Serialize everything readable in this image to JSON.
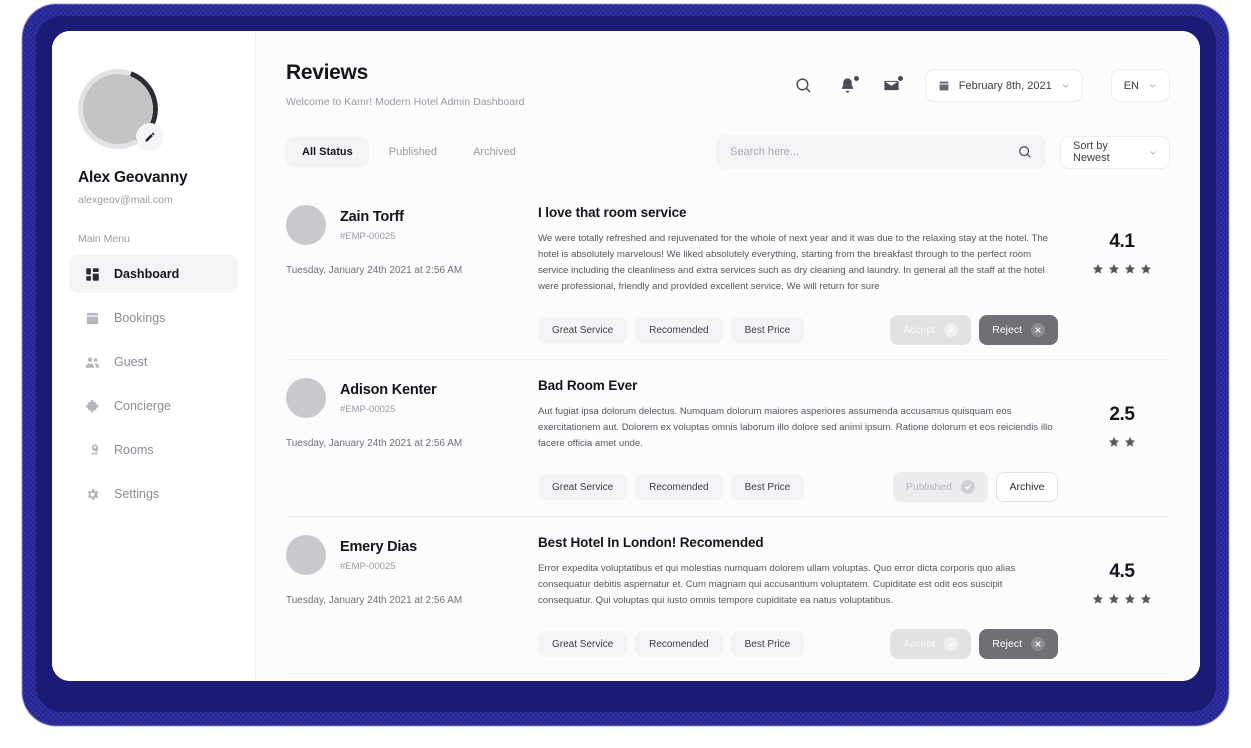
{
  "sidebar": {
    "profile": {
      "name": "Alex Geovanny",
      "email": "alexgeov@mail.com",
      "edit_icon": "pencil-icon"
    },
    "menu_label": "Main Menu",
    "items": [
      {
        "label": "Dashboard",
        "icon": "dashboard-grid-icon",
        "active": true
      },
      {
        "label": "Bookings",
        "icon": "calendar-icon",
        "active": false
      },
      {
        "label": "Guest",
        "icon": "people-icon",
        "active": false
      },
      {
        "label": "Concierge",
        "icon": "puzzle-icon",
        "active": false
      },
      {
        "label": "Rooms",
        "icon": "key-icon",
        "active": false
      },
      {
        "label": "Settings",
        "icon": "gear-icon",
        "active": false
      }
    ]
  },
  "header": {
    "title": "Reviews",
    "subtitle": "Welcome to Kamr! Modern Hotel Admin Dashboard",
    "icons": [
      {
        "name": "search-icon",
        "badge": false
      },
      {
        "name": "bell-icon",
        "badge": true
      },
      {
        "name": "mail-icon",
        "badge": true
      }
    ],
    "date_picker": {
      "icon": "calendar-icon",
      "value": "February 8th, 2021"
    },
    "language": {
      "value": "EN"
    }
  },
  "filters": {
    "tabs": [
      {
        "label": "All Status",
        "active": true
      },
      {
        "label": "Published",
        "active": false
      },
      {
        "label": "Archived",
        "active": false
      }
    ],
    "search": {
      "placeholder": "Search here...",
      "value": "",
      "icon": "search-icon"
    },
    "sort": {
      "value": "Sort by Newest"
    }
  },
  "reviews": [
    {
      "user": {
        "name": "Zain Torff",
        "id": "#EMP-00025",
        "date": "Tuesday, January 24th 2021 at 2:56 AM"
      },
      "title": "I love that room service",
      "text": "We were totally refreshed and rejuvenated for the whole of next year and it was due to the relaxing stay at the hotel. The hotel is absolutely marvelous! We liked absolutely everything, starting from the breakfast through to the perfect room service including the cleanliness and extra services such as dry cleaning and laundry. In general all the staff at the hotel were professional, friendly and provided excellent service. We will return for sure",
      "tags": [
        "Great Service",
        "Recomended",
        "Best Price"
      ],
      "actions": [
        {
          "label": "Accept",
          "style": "accept",
          "icon": "check-circle-icon"
        },
        {
          "label": "Reject",
          "style": "reject",
          "icon": "x-circle-icon"
        }
      ],
      "rating": "4.1",
      "stars": 4
    },
    {
      "user": {
        "name": "Adison Kenter",
        "id": "#EMP-00025",
        "date": "Tuesday, January 24th 2021 at 2:56 AM"
      },
      "title": "Bad Room Ever",
      "text": "Aut fugiat ipsa dolorum delectus. Numquam dolorum maiores asperiores assumenda accusamus quisquam eos exercitationem aut. Dolorem ex voluptas omnis laborum illo dolore sed animi ipsum. Ratione dolorum et eos reiciendis illo facere officia amet unde.",
      "tags": [
        "Great Service",
        "Recomended",
        "Best Price"
      ],
      "actions": [
        {
          "label": "Published",
          "style": "published",
          "icon": "check-circle-icon"
        },
        {
          "label": "Archive",
          "style": "archive",
          "icon": ""
        }
      ],
      "rating": "2.5",
      "stars": 2
    },
    {
      "user": {
        "name": "Emery Dias",
        "id": "#EMP-00025",
        "date": "Tuesday, January 24th 2021 at 2:56 AM"
      },
      "title": "Best Hotel In London! Recomended",
      "text": "Error expedita voluptatibus et qui molestias numquam dolorem ullam voluptas. Quo error dicta corporis quo alias consequatur debitis aspernatur et. Cum magnam qui accusantium voluptatem. Cupiditate est odit eos suscipit consequatur. Qui voluptas qui iusto omnis tempore cupiditate ea natus voluptatibus.",
      "tags": [
        "Great Service",
        "Recomended",
        "Best Price"
      ],
      "actions": [
        {
          "label": "Accept",
          "style": "accept",
          "icon": "check-circle-icon"
        },
        {
          "label": "Reject",
          "style": "reject",
          "icon": "x-circle-icon"
        }
      ],
      "rating": "4.5",
      "stars": 4
    }
  ],
  "colors": {
    "frame": "#1b1b75",
    "accent_dark": "#14141c",
    "muted": "#9a9aa4",
    "surface": "#f4f4f6"
  }
}
